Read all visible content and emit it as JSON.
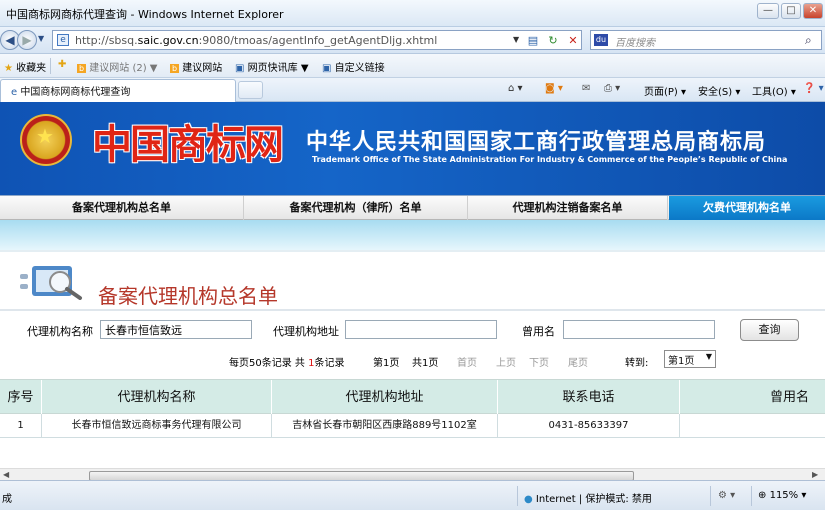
{
  "browser": {
    "window_title": "中国商标网商标代理查询 - Windows Internet Explorer",
    "url_prefix": "http://sbsq.",
    "url_host": "saic.gov.cn",
    "url_rest": ":9080/tmoas/agentInfo_getAgentDljg.xhtml",
    "search_placeholder": "百度搜索",
    "favorites_label": "收藏夹",
    "fav_items": [
      "建议网站 (2) ▼",
      "建议网站",
      "网页快讯库 ▼",
      "自定义链接"
    ],
    "tab_title": "中国商标网商标代理查询",
    "cmd_page": "页面(P) ▾",
    "cmd_safety": "安全(S) ▾",
    "cmd_tools": "工具(O) ▾",
    "cmd_help": "❓ ▾"
  },
  "banner": {
    "logo_text": "中国商标网",
    "title": "中华人民共和国国家工商行政管理总局商标局",
    "subtitle": "Trademark Office of The State Administration For Industry & Commerce of the People’s Republic of China"
  },
  "menu": {
    "items": [
      "备案代理机构总名单",
      "备案代理机构（律所）名单",
      "代理机构注销备案名单",
      "欠费代理机构名单"
    ]
  },
  "page": {
    "title": "备案代理机构总名单"
  },
  "search_form": {
    "name_label": "代理机构名称",
    "name_value": "长春市恒信致远",
    "addr_label": "代理机构地址",
    "addr_value": "",
    "former_label": "曾用名",
    "former_value": "",
    "query_button": "查询"
  },
  "pager": {
    "per_page": "每页50条记录",
    "total_prefix": "共",
    "total_count": "1",
    "total_suffix": "条记录",
    "current": "第1页",
    "total_pages": "共1页",
    "first": "首页",
    "prev": "上页",
    "next": "下页",
    "last": "尾页",
    "goto_label": "转到:",
    "goto_value": "第1页"
  },
  "table": {
    "headers": [
      "序号",
      "代理机构名称",
      "代理机构地址",
      "联系电话",
      "曾用名"
    ],
    "rows": [
      [
        "1",
        "长春市恒信致远商标事务代理有限公司",
        "吉林省长春市朝阳区西康路889号1102室",
        "0431-85633397",
        ""
      ]
    ]
  },
  "status_bar": {
    "left": "成",
    "zone": "Internet | 保护模式: 禁用",
    "zoom": "115%"
  }
}
